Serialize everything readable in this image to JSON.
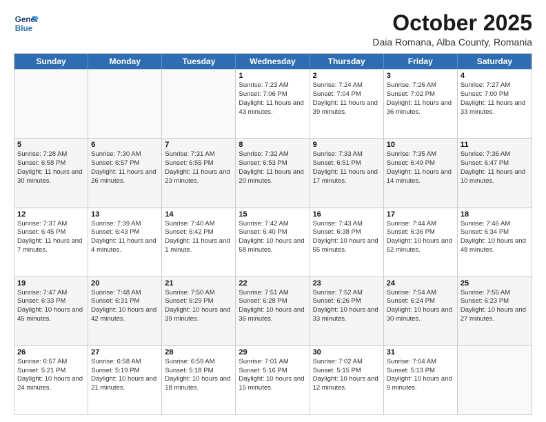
{
  "header": {
    "logo_line1": "General",
    "logo_line2": "Blue",
    "month": "October 2025",
    "location": "Daia Romana, Alba County, Romania"
  },
  "weekdays": [
    "Sunday",
    "Monday",
    "Tuesday",
    "Wednesday",
    "Thursday",
    "Friday",
    "Saturday"
  ],
  "rows": [
    [
      {
        "day": "",
        "text": ""
      },
      {
        "day": "",
        "text": ""
      },
      {
        "day": "",
        "text": ""
      },
      {
        "day": "1",
        "text": "Sunrise: 7:23 AM\nSunset: 7:06 PM\nDaylight: 11 hours and 43 minutes."
      },
      {
        "day": "2",
        "text": "Sunrise: 7:24 AM\nSunset: 7:04 PM\nDaylight: 11 hours and 39 minutes."
      },
      {
        "day": "3",
        "text": "Sunrise: 7:26 AM\nSunset: 7:02 PM\nDaylight: 11 hours and 36 minutes."
      },
      {
        "day": "4",
        "text": "Sunrise: 7:27 AM\nSunset: 7:00 PM\nDaylight: 11 hours and 33 minutes."
      }
    ],
    [
      {
        "day": "5",
        "text": "Sunrise: 7:28 AM\nSunset: 6:58 PM\nDaylight: 11 hours and 30 minutes."
      },
      {
        "day": "6",
        "text": "Sunrise: 7:30 AM\nSunset: 6:57 PM\nDaylight: 11 hours and 26 minutes."
      },
      {
        "day": "7",
        "text": "Sunrise: 7:31 AM\nSunset: 6:55 PM\nDaylight: 11 hours and 23 minutes."
      },
      {
        "day": "8",
        "text": "Sunrise: 7:32 AM\nSunset: 6:53 PM\nDaylight: 11 hours and 20 minutes."
      },
      {
        "day": "9",
        "text": "Sunrise: 7:33 AM\nSunset: 6:51 PM\nDaylight: 11 hours and 17 minutes."
      },
      {
        "day": "10",
        "text": "Sunrise: 7:35 AM\nSunset: 6:49 PM\nDaylight: 11 hours and 14 minutes."
      },
      {
        "day": "11",
        "text": "Sunrise: 7:36 AM\nSunset: 6:47 PM\nDaylight: 11 hours and 10 minutes."
      }
    ],
    [
      {
        "day": "12",
        "text": "Sunrise: 7:37 AM\nSunset: 6:45 PM\nDaylight: 11 hours and 7 minutes."
      },
      {
        "day": "13",
        "text": "Sunrise: 7:39 AM\nSunset: 6:43 PM\nDaylight: 11 hours and 4 minutes."
      },
      {
        "day": "14",
        "text": "Sunrise: 7:40 AM\nSunset: 6:42 PM\nDaylight: 11 hours and 1 minute."
      },
      {
        "day": "15",
        "text": "Sunrise: 7:42 AM\nSunset: 6:40 PM\nDaylight: 10 hours and 58 minutes."
      },
      {
        "day": "16",
        "text": "Sunrise: 7:43 AM\nSunset: 6:38 PM\nDaylight: 10 hours and 55 minutes."
      },
      {
        "day": "17",
        "text": "Sunrise: 7:44 AM\nSunset: 6:36 PM\nDaylight: 10 hours and 52 minutes."
      },
      {
        "day": "18",
        "text": "Sunrise: 7:46 AM\nSunset: 6:34 PM\nDaylight: 10 hours and 48 minutes."
      }
    ],
    [
      {
        "day": "19",
        "text": "Sunrise: 7:47 AM\nSunset: 6:33 PM\nDaylight: 10 hours and 45 minutes."
      },
      {
        "day": "20",
        "text": "Sunrise: 7:48 AM\nSunset: 6:31 PM\nDaylight: 10 hours and 42 minutes."
      },
      {
        "day": "21",
        "text": "Sunrise: 7:50 AM\nSunset: 6:29 PM\nDaylight: 10 hours and 39 minutes."
      },
      {
        "day": "22",
        "text": "Sunrise: 7:51 AM\nSunset: 6:28 PM\nDaylight: 10 hours and 36 minutes."
      },
      {
        "day": "23",
        "text": "Sunrise: 7:52 AM\nSunset: 6:26 PM\nDaylight: 10 hours and 33 minutes."
      },
      {
        "day": "24",
        "text": "Sunrise: 7:54 AM\nSunset: 6:24 PM\nDaylight: 10 hours and 30 minutes."
      },
      {
        "day": "25",
        "text": "Sunrise: 7:55 AM\nSunset: 6:23 PM\nDaylight: 10 hours and 27 minutes."
      }
    ],
    [
      {
        "day": "26",
        "text": "Sunrise: 6:57 AM\nSunset: 5:21 PM\nDaylight: 10 hours and 24 minutes."
      },
      {
        "day": "27",
        "text": "Sunrise: 6:58 AM\nSunset: 5:19 PM\nDaylight: 10 hours and 21 minutes."
      },
      {
        "day": "28",
        "text": "Sunrise: 6:59 AM\nSunset: 5:18 PM\nDaylight: 10 hours and 18 minutes."
      },
      {
        "day": "29",
        "text": "Sunrise: 7:01 AM\nSunset: 5:16 PM\nDaylight: 10 hours and 15 minutes."
      },
      {
        "day": "30",
        "text": "Sunrise: 7:02 AM\nSunset: 5:15 PM\nDaylight: 10 hours and 12 minutes."
      },
      {
        "day": "31",
        "text": "Sunrise: 7:04 AM\nSunset: 5:13 PM\nDaylight: 10 hours and 9 minutes."
      },
      {
        "day": "",
        "text": ""
      }
    ]
  ]
}
